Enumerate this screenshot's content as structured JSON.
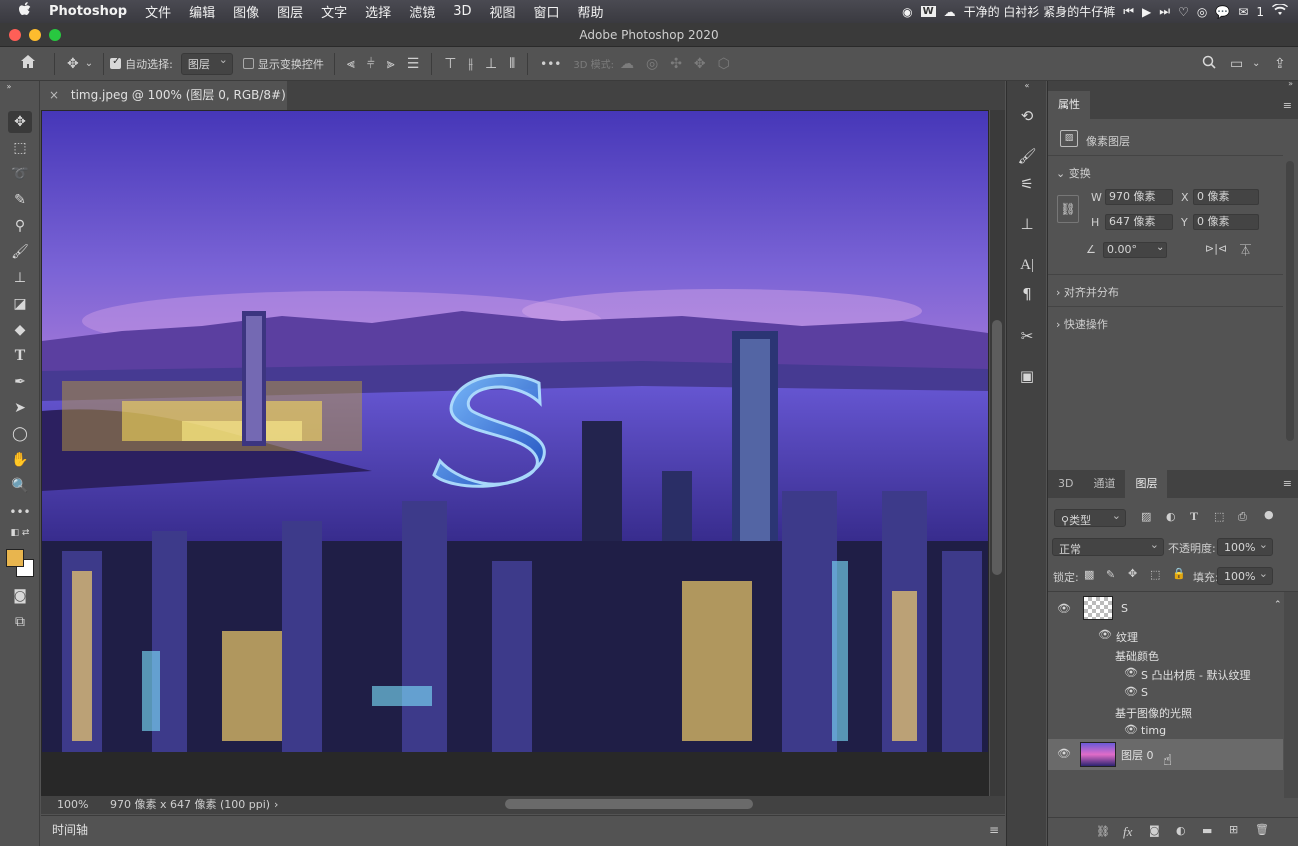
{
  "menubar": {
    "apple": "",
    "items": [
      "Photoshop",
      "文件",
      "编辑",
      "图像",
      "图层",
      "文字",
      "选择",
      "滤镜",
      "3D",
      "视图",
      "窗口",
      "帮助"
    ],
    "now_playing": "干净的 白衬衫 紧身的牛仔裤",
    "badge_count": "1"
  },
  "window": {
    "title": "Adobe Photoshop 2020"
  },
  "options": {
    "auto_select_label": "自动选择:",
    "auto_select_checked": true,
    "auto_select_target": "图层",
    "show_transform_label": "显示变换控件",
    "show_transform_checked": false,
    "more": "•••",
    "mode_3d_label": "3D 模式:"
  },
  "document": {
    "tab_label": "timg.jpeg @ 100% (图层 0, RGB/8#) *",
    "close": "×",
    "zoom": "100%",
    "info": "970 像素 x 647 像素 (100 ppi)",
    "info_arrow": "›",
    "timeline_label": "时间轴"
  },
  "properties": {
    "tab": "属性",
    "pixel_layer_label": "像素图层",
    "transform_title": "变换",
    "w_label": "W",
    "w_value": "970 像素",
    "h_label": "H",
    "h_value": "647 像素",
    "x_label": "X",
    "x_value": "0 像素",
    "y_label": "Y",
    "y_value": "0 像素",
    "angle_value": "0.00°",
    "align_title": "对齐并分布",
    "quick_title": "快速操作"
  },
  "layers_panel": {
    "tabs": [
      "3D",
      "通道",
      "图层"
    ],
    "active_tab": "图层",
    "filter_kind": "类型",
    "blend_mode": "正常",
    "opacity_label": "不透明度:",
    "opacity_value": "100%",
    "lock_label": "锁定:",
    "fill_label": "填充:",
    "fill_value": "100%",
    "layers": [
      {
        "name": "S",
        "visible": true
      },
      {
        "name": "纹理",
        "visible": true
      },
      {
        "name": "基础颜色",
        "visible": false
      },
      {
        "name": "S 凸出材质 - 默认纹理",
        "visible": true
      },
      {
        "name": "S",
        "visible": true
      },
      {
        "name": "基于图像的光照",
        "visible": false
      },
      {
        "name": "timg",
        "visible": true
      },
      {
        "name": "图层 0",
        "visible": true
      }
    ],
    "footer_fx": "fx"
  },
  "colors": {
    "foreground": "#e8b54e",
    "background": "#ffffff",
    "sky_top": "#4a3db5",
    "sky_mid": "#9a6fd8",
    "horizon": "#e36fc9",
    "water": "#3b2c9e"
  }
}
